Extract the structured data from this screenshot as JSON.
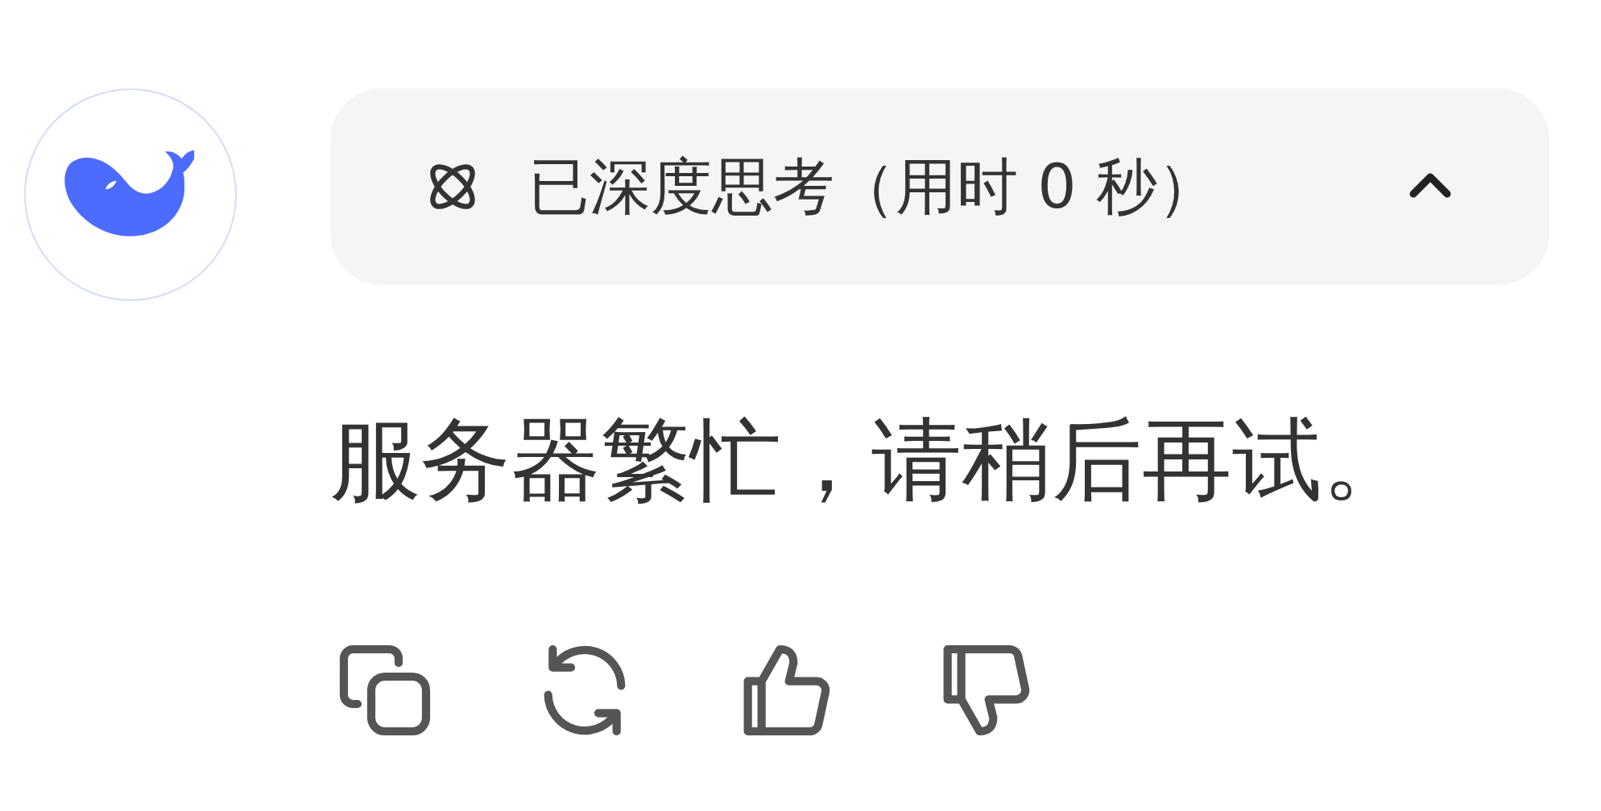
{
  "thinking": {
    "label": "已深度思考（用时 0 秒）",
    "expanded": true
  },
  "message": "服务器繁忙，请稍后再试。",
  "actions": [
    {
      "kind": "copy"
    },
    {
      "kind": "regenerate"
    },
    {
      "kind": "like"
    },
    {
      "kind": "dislike"
    }
  ]
}
